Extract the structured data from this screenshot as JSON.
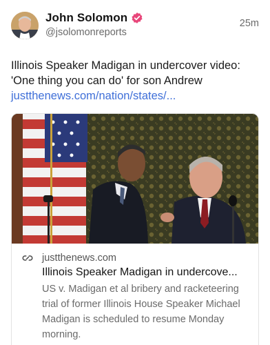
{
  "author": {
    "display_name": "John Solomon",
    "handle": "@jsolomonreports",
    "verified": true,
    "verified_color": "#e8467a"
  },
  "timestamp": "25m",
  "post": {
    "text": "Illinois Speaker Madigan in undercover video: 'One thing you can do' for son Andrew",
    "link": "justthenews.com/nation/states/..."
  },
  "card": {
    "domain": "justthenews.com",
    "title": "Illinois Speaker Madigan in undercove...",
    "description": "US v. Madigan et al bribery and racketeering trial of former Illinois House Speaker Michael Madigan is scheduled to resume Monday morning.",
    "icon": "link-icon"
  },
  "colors": {
    "link": "#3f6fd8",
    "muted": "#6a6a6a",
    "text": "#141414"
  }
}
